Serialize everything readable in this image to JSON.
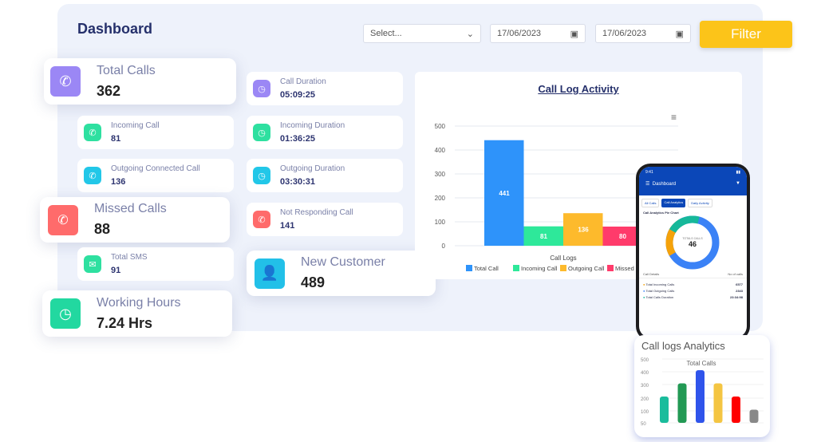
{
  "header": {
    "title": "Dashboard",
    "select_placeholder": "Select...",
    "date_from": "17/06/2023",
    "date_to": "17/06/2023",
    "filter_label": "Filter"
  },
  "cards": {
    "total_calls": {
      "label": "Total Calls",
      "value": "362"
    },
    "incoming_call": {
      "label": "Incoming Call",
      "value": "81"
    },
    "outgoing_connected": {
      "label": "Outgoing Connected Call",
      "value": "136"
    },
    "missed_calls": {
      "label": "Missed Calls",
      "value": "88"
    },
    "total_sms": {
      "label": "Total SMS",
      "value": "91"
    },
    "working_hours": {
      "label": "Working Hours",
      "value": "7.24 Hrs"
    },
    "call_duration": {
      "label": "Call Duration",
      "value": "05:09:25"
    },
    "incoming_duration": {
      "label": "Incoming Duration",
      "value": "01:36:25"
    },
    "outgoing_duration": {
      "label": "Outgoing Duration",
      "value": "03:30:31"
    },
    "not_responding": {
      "label": "Not Responding Call",
      "value": "141"
    },
    "new_customer": {
      "label": "New Customer",
      "value": "489"
    }
  },
  "chart_data": [
    {
      "type": "bar",
      "title": "Call Log Activity",
      "xlabel": "Call Logs",
      "ylim": [
        0,
        500
      ],
      "yticks": [
        "0",
        "100",
        "200",
        "300",
        "400",
        "500"
      ],
      "series": [
        {
          "name": "Total Call",
          "value": 441,
          "color": "#2e93fa"
        },
        {
          "name": "Incoming Call",
          "value": 81,
          "color": "#2ee89a"
        },
        {
          "name": "Outgoing Call",
          "value": 136,
          "color": "#fdba2c"
        },
        {
          "name": "Missed Call",
          "value": 80,
          "color": "#ff3b6b"
        }
      ],
      "legend": "bottom",
      "grid": true
    },
    {
      "type": "bar",
      "title": "Call logs Analytics",
      "subtitle": "Total Calls",
      "yticks": [
        "50",
        "100",
        "200",
        "300",
        "400",
        "500"
      ],
      "values": [
        200,
        300,
        400,
        300,
        200,
        100
      ],
      "colors": [
        "#1abc9c",
        "#229954",
        "#2f54eb",
        "#f4c542",
        "#ff0000",
        "#888888"
      ]
    }
  ],
  "phone": {
    "time": "9:41",
    "title": "Dashboard",
    "tabs": [
      "All Calls",
      "Call Analytics",
      "Daily Activity"
    ],
    "pie_title": "Call Analytics Pie Chart",
    "center_label": "TOTALS CALLS",
    "center_value": "46",
    "table_headers": [
      "Call Details",
      "No of calls"
    ],
    "rows": [
      {
        "label": "Total Incoming Calls",
        "value": "6577",
        "color": "#f5a20a"
      },
      {
        "label": "Total Outgoing Calls",
        "value": "2343",
        "color": "#3b82f6"
      },
      {
        "label": "Total Calls Duration",
        "value": "23:34:98",
        "color": "#16b89a"
      }
    ]
  }
}
